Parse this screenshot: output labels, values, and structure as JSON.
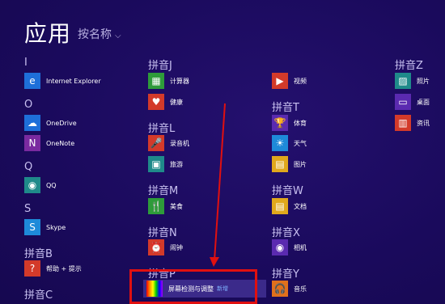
{
  "header": {
    "title": "应用",
    "sort_label": "按名称",
    "sort_chevron": "⌵"
  },
  "groups": {
    "I": "I",
    "O": "O",
    "Q": "Q",
    "S": "S",
    "B": "拼音B",
    "C": "拼音C",
    "J": "拼音J",
    "L": "拼音L",
    "M": "拼音M",
    "N": "拼音N",
    "P": "拼音P",
    "T": "拼音T",
    "W": "拼音W",
    "X": "拼音X",
    "Y": "拼音Y",
    "Z": "拼音Z"
  },
  "apps": {
    "ie": "Internet Explorer",
    "onedrive": "OneDrive",
    "onenote": "OneNote",
    "qq": "QQ",
    "skype": "Skype",
    "help": "帮助 + 提示",
    "calc": "计算器",
    "health": "健康",
    "recorder": "录音机",
    "travel": "旅游",
    "food": "美食",
    "alarm": "闹钟",
    "screen": "屏幕检测与调整",
    "screen_new": "新增",
    "video": "视频",
    "sports": "体育",
    "weather": "天气",
    "photos": "图片",
    "docs": "文档",
    "camera": "相机",
    "music": "音乐",
    "photos2": "照片",
    "desktop": "桌面",
    "news": "资讯"
  },
  "colors": {
    "background": "#1a0a5c",
    "tile_blue": "#1e6fd9",
    "tile_green": "#2e9b3a",
    "tile_red": "#d33a2a",
    "tile_orange": "#e0701c",
    "tile_purple": "#5a2ab0",
    "tile_teal": "#1f8a8a",
    "highlight": "#e01010"
  }
}
